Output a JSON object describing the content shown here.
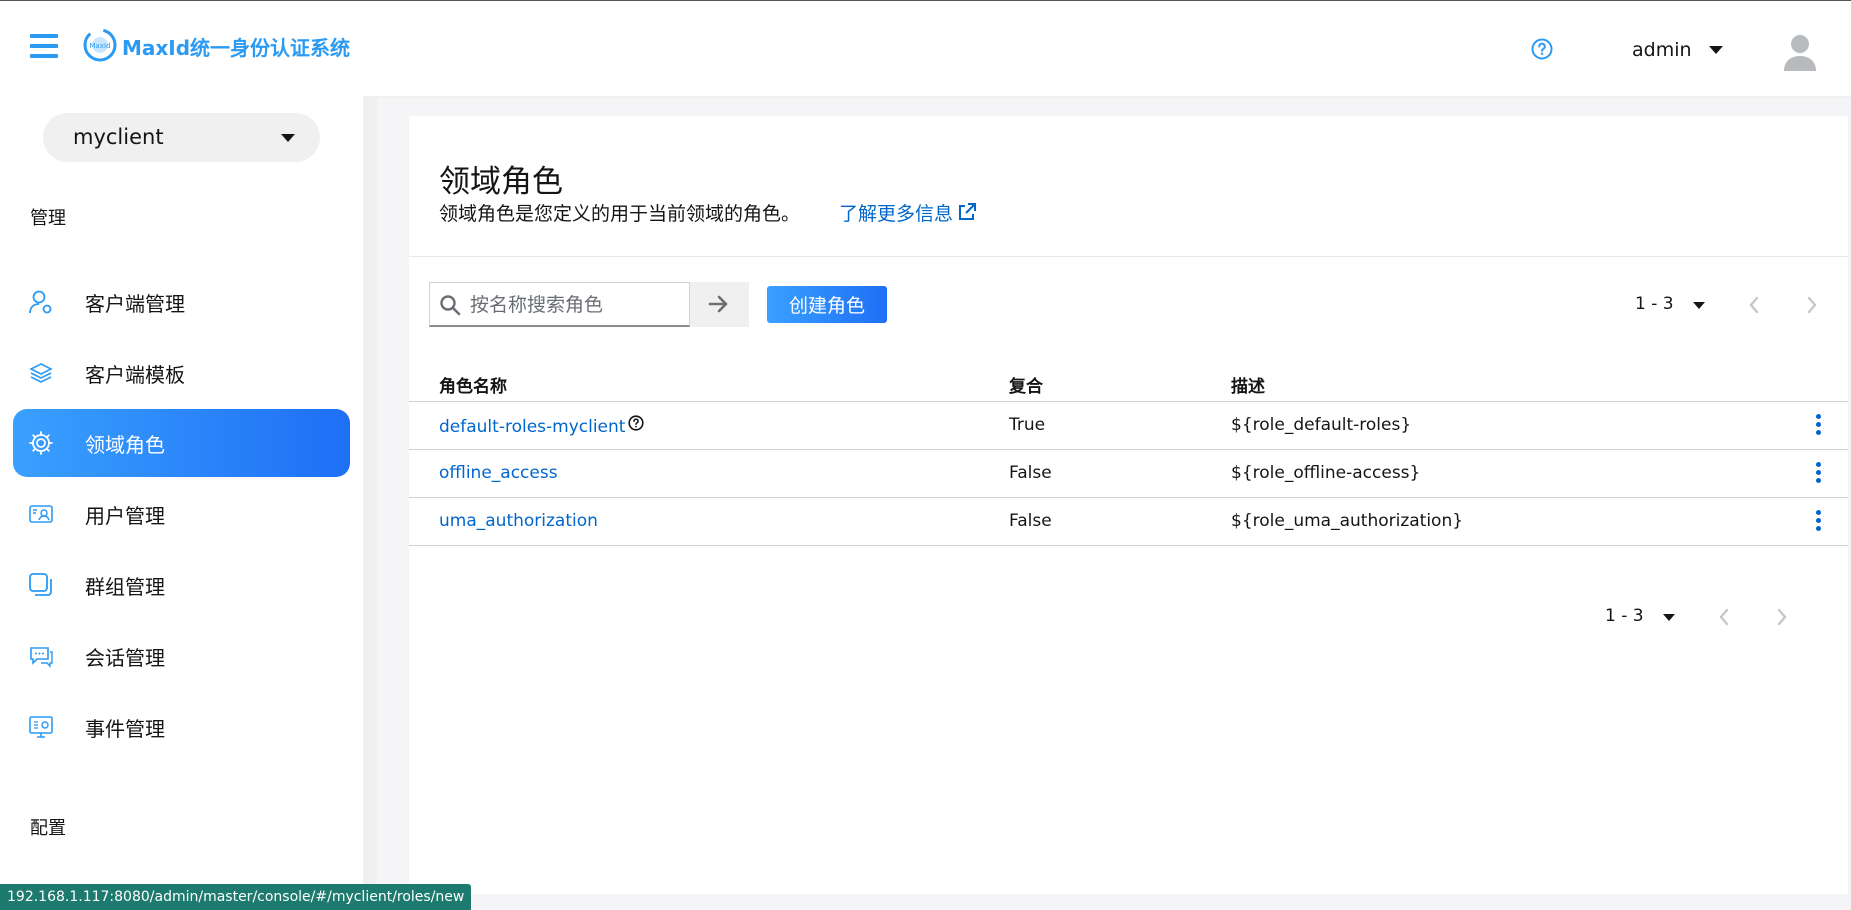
{
  "header": {
    "brand": "MaxId统一身份认证系统",
    "user": "admin"
  },
  "sidebar": {
    "realm": "myclient",
    "section_manage": "管理",
    "section_config": "配置",
    "items": [
      {
        "label": "客户端管理",
        "icon": "user-icon"
      },
      {
        "label": "客户端模板",
        "icon": "layers-icon"
      },
      {
        "label": "领域角色",
        "icon": "gear-icon"
      },
      {
        "label": "用户管理",
        "icon": "id-card-icon"
      },
      {
        "label": "群组管理",
        "icon": "group-icon"
      },
      {
        "label": "会话管理",
        "icon": "chat-icon"
      },
      {
        "label": "事件管理",
        "icon": "monitor-icon"
      }
    ],
    "active_index": 2
  },
  "page": {
    "title": "领域角色",
    "description": "领域角色是您定义的用于当前领域的角色。",
    "learn_more": "了解更多信息"
  },
  "toolbar": {
    "search_placeholder": "按名称搜索角色",
    "create_label": "创建角色"
  },
  "pagination": {
    "range": "1 - 3"
  },
  "table": {
    "columns": [
      "角色名称",
      "复合",
      "描述"
    ],
    "rows": [
      {
        "name": "default-roles-myclient",
        "composite": "True",
        "description": "${role_default-roles}"
      },
      {
        "name": "offline_access",
        "composite": "False",
        "description": "${role_offline-access}"
      },
      {
        "name": "uma_authorization",
        "composite": "False",
        "description": "${role_uma_authorization}"
      }
    ]
  },
  "status_bar": "192.168.1.117:8080/admin/master/console/#/myclient/roles/new",
  "colors": {
    "accent": "#2b9af3",
    "link": "#0066cc",
    "status_bar": "#1c7a6e"
  }
}
